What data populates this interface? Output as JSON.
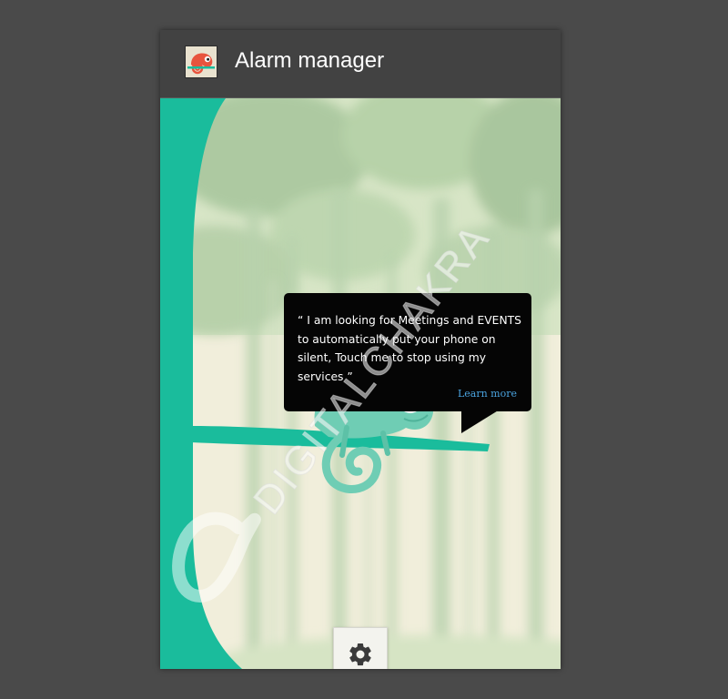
{
  "app_bar": {
    "title": "Alarm manager",
    "icon": "chameleon-logo-icon"
  },
  "speech_bubble": {
    "text": "“ I am looking for Meetings and EVENTS to automatically put your phone on silent, Touch me to stop using my services ”",
    "link_label": "Learn more"
  },
  "settings": {
    "icon": "gear-icon"
  },
  "watermark": {
    "text": "DIGITALCHAKRA"
  },
  "colors": {
    "app_bar": "#424242",
    "teal": "#1abc9c",
    "chameleon": "#6fcdb4",
    "bubble": "#050505",
    "link": "#4aa3df"
  }
}
